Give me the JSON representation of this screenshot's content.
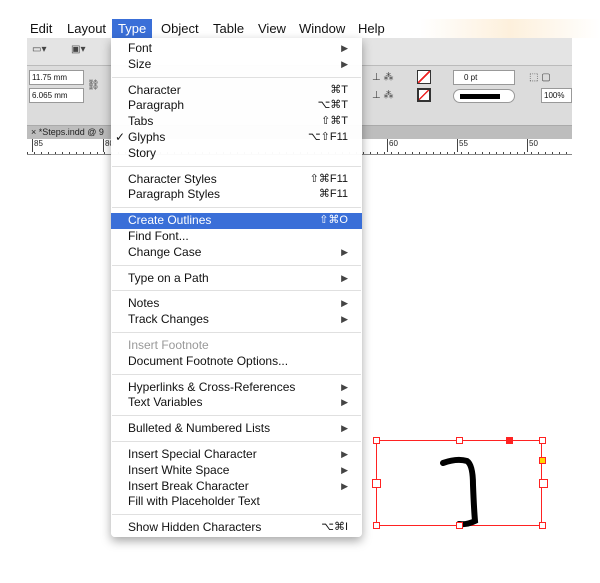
{
  "menubar": {
    "items": [
      "Edit",
      "Layout",
      "Type",
      "Object",
      "Table",
      "View",
      "Window",
      "Help"
    ],
    "active": "Type"
  },
  "control_panel": {
    "width": "11.75 mm",
    "height": "6.065 mm",
    "stroke_weight": "0 pt",
    "opacity": "100%"
  },
  "document_tab": {
    "label": "*Steps.indd @ 9"
  },
  "ruler": {
    "labels": [
      "85",
      "80",
      "60",
      "55",
      "50"
    ]
  },
  "type_menu": [
    {
      "label": "Font",
      "submenu": true
    },
    {
      "label": "Size",
      "submenu": true
    },
    {
      "sep": true
    },
    {
      "label": "Character",
      "shortcut": "⌘T"
    },
    {
      "label": "Paragraph",
      "shortcut": "⌥⌘T"
    },
    {
      "label": "Tabs",
      "shortcut": "⇧⌘T"
    },
    {
      "label": "Glyphs",
      "shortcut": "⌥⇧F11",
      "checked": true
    },
    {
      "label": "Story"
    },
    {
      "sep": true
    },
    {
      "label": "Character Styles",
      "shortcut": "⇧⌘F11"
    },
    {
      "label": "Paragraph Styles",
      "shortcut": "⌘F11"
    },
    {
      "sep": true
    },
    {
      "label": "Create Outlines",
      "shortcut": "⇧⌘O",
      "highlighted": true
    },
    {
      "label": "Find Font..."
    },
    {
      "label": "Change Case",
      "submenu": true
    },
    {
      "sep": true
    },
    {
      "label": "Type on a Path",
      "submenu": true
    },
    {
      "sep": true
    },
    {
      "label": "Notes",
      "submenu": true
    },
    {
      "label": "Track Changes",
      "submenu": true
    },
    {
      "sep": true
    },
    {
      "label": "Insert Footnote",
      "disabled": true
    },
    {
      "label": "Document Footnote Options..."
    },
    {
      "sep": true
    },
    {
      "label": "Hyperlinks & Cross-References",
      "submenu": true
    },
    {
      "label": "Text Variables",
      "submenu": true
    },
    {
      "sep": true
    },
    {
      "label": "Bulleted & Numbered Lists",
      "submenu": true
    },
    {
      "sep": true
    },
    {
      "label": "Insert Special Character",
      "submenu": true
    },
    {
      "label": "Insert White Space",
      "submenu": true
    },
    {
      "label": "Insert Break Character",
      "submenu": true
    },
    {
      "label": "Fill with Placeholder Text"
    },
    {
      "sep": true
    },
    {
      "label": "Show Hidden Characters",
      "shortcut": "⌥⌘I"
    }
  ],
  "colors": {
    "highlight": "#3a6fd8",
    "selection": "#ff2222"
  }
}
